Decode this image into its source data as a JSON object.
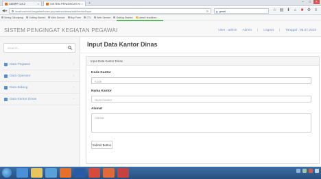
{
  "browser": {
    "tabs": [
      {
        "title": "XAMPP 1.8.2",
        "close": "×"
      },
      {
        "title": "SISTEM PENGINGAT KEGIA...",
        "close": "×"
      }
    ],
    "new_tab": "+",
    "url": "localhost/sisit-kegiatan/index.php/admin/dinas/add/kantor/input",
    "search_engine": "g",
    "search_query": "gmail",
    "bookmarks": [
      {
        "label": "Sering Dikunjungi",
        "color": "#9aa3ad"
      },
      {
        "label": "Getting Started",
        "color": "#9aa3ad"
      },
      {
        "label": "Web Service",
        "color": "#9aa3ad"
      },
      {
        "label": "Buy Form",
        "color": "#9aa3ad"
      },
      {
        "label": "CTL",
        "color": "#9aa3ad"
      },
      {
        "label": "Web Service",
        "color": "#9aa3ad"
      },
      {
        "label": "Getting Started",
        "color": "#9aa3ad"
      },
      {
        "label": "Latest Headlines",
        "color": "#e4b532"
      }
    ]
  },
  "app": {
    "title": "SISTEM PENGINGAT KEGIATAN PEGAWAI",
    "header_links": {
      "user": "User : admin",
      "role": "Admin",
      "logout": "Logout",
      "date": "Tanggal : 06.07.2015"
    }
  },
  "sidebar": {
    "search_placeholder": "Search...",
    "items": [
      {
        "label": "Data Pegawai"
      },
      {
        "label": "Data Operator"
      },
      {
        "label": "Data Bidang"
      },
      {
        "label": "Data Kantor Dinas"
      }
    ],
    "chevron": "›"
  },
  "main": {
    "page_title": "Input Data Kantor Dinas",
    "panel_heading": "Input Data Kantor Dinas",
    "fields": {
      "kode": {
        "label": "Kode Kantor",
        "placeholder": "Kode"
      },
      "nama": {
        "label": "Nama Kantor",
        "placeholder": "Nama kantor"
      },
      "alamat": {
        "label": "Alamat",
        "placeholder": "Alamat"
      }
    },
    "submit_label": "Submit Button"
  },
  "taskbar": {
    "icons": [
      {
        "name": "ie",
        "color": "#4a90d9"
      },
      {
        "name": "explorer",
        "color": "#e8c45a"
      },
      {
        "name": "media",
        "color": "#5aa0d8"
      },
      {
        "name": "firefox",
        "color": "#e6702a"
      },
      {
        "name": "photoshop",
        "color": "#2b5aa5"
      },
      {
        "name": "chrome",
        "color": "#d84a3a"
      },
      {
        "name": "folder",
        "color": "#e06a3a"
      },
      {
        "name": "paint",
        "color": "#c84040"
      }
    ]
  }
}
